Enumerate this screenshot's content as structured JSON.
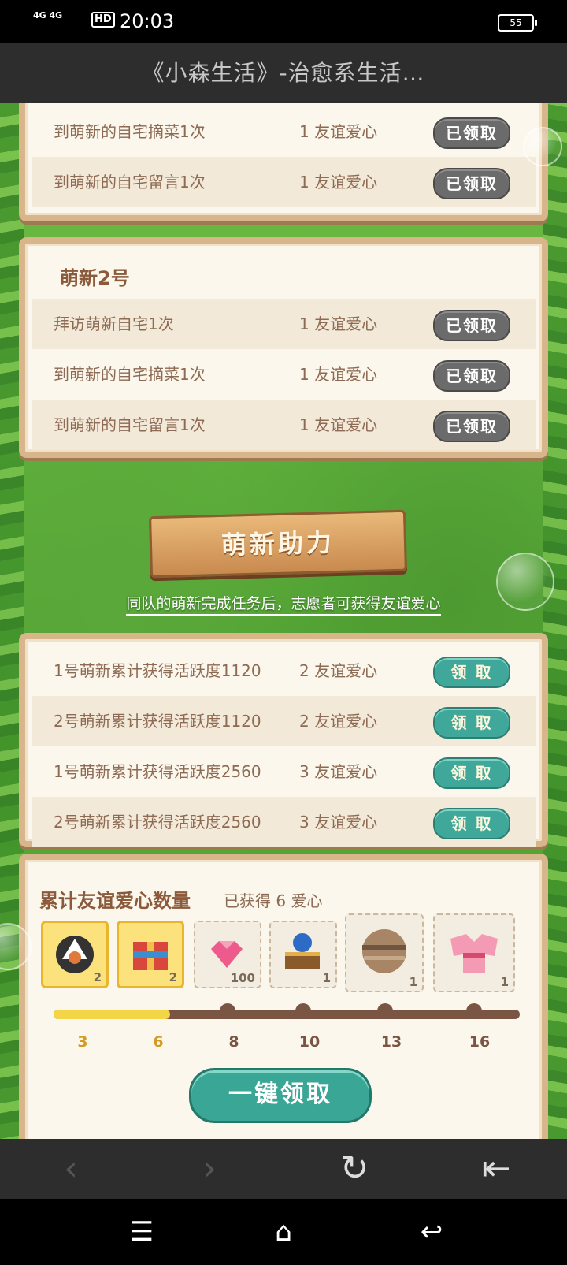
{
  "status_bar": {
    "signal_1": "4G",
    "signal_2": "4G",
    "hd": "HD",
    "time": "20:03",
    "battery": "55"
  },
  "title": "《小森生活》-治愈系生活…",
  "card1": {
    "rows": [
      {
        "task": "到萌新的自宅摘菜1次",
        "reward": "1 友谊爱心",
        "button": "已领取"
      },
      {
        "task": "到萌新的自宅留言1次",
        "reward": "1 友谊爱心",
        "button": "已领取"
      }
    ]
  },
  "card2": {
    "heading": "萌新2号",
    "rows": [
      {
        "task": "拜访萌新自宅1次",
        "reward": "1 友谊爱心",
        "button": "已领取"
      },
      {
        "task": "到萌新的自宅摘菜1次",
        "reward": "1 友谊爱心",
        "button": "已领取"
      },
      {
        "task": "到萌新的自宅留言1次",
        "reward": "1 友谊爱心",
        "button": "已领取"
      }
    ]
  },
  "banner": {
    "title": "萌新助力",
    "note": "同队的萌新完成任务后，志愿者可获得友谊爱心"
  },
  "card3": {
    "rows": [
      {
        "task": "1号萌新累计获得活跃度1120",
        "reward": "2 友谊爱心",
        "button": "领 取"
      },
      {
        "task": "2号萌新累计获得活跃度1120",
        "reward": "2 友谊爱心",
        "button": "领 取"
      },
      {
        "task": "1号萌新累计获得活跃度2560",
        "reward": "3 友谊爱心",
        "button": "领 取"
      },
      {
        "task": "2号萌新累计获得活跃度2560",
        "reward": "3 友谊爱心",
        "button": "领 取"
      }
    ]
  },
  "card4": {
    "heading": "累计友谊爱心数量",
    "obtained": "已获得 6 爱心",
    "items": [
      {
        "icon": "onigiri-icon",
        "count": "2"
      },
      {
        "icon": "gift-box-icon",
        "count": "2"
      },
      {
        "icon": "pink-gem-icon",
        "count": "100"
      },
      {
        "icon": "firework-box-icon",
        "count": "1"
      },
      {
        "icon": "planet-ball-icon",
        "count": "1"
      },
      {
        "icon": "kimono-icon",
        "count": "1"
      }
    ],
    "milestones": [
      "3",
      "6",
      "8",
      "10",
      "13",
      "16"
    ],
    "progress_fraction": 0.25,
    "claim_all": "一键领取"
  },
  "colors": {
    "claim_button": "#3fa89a",
    "done_button": "#6b6b6b",
    "card_border": "#d9b58c"
  }
}
